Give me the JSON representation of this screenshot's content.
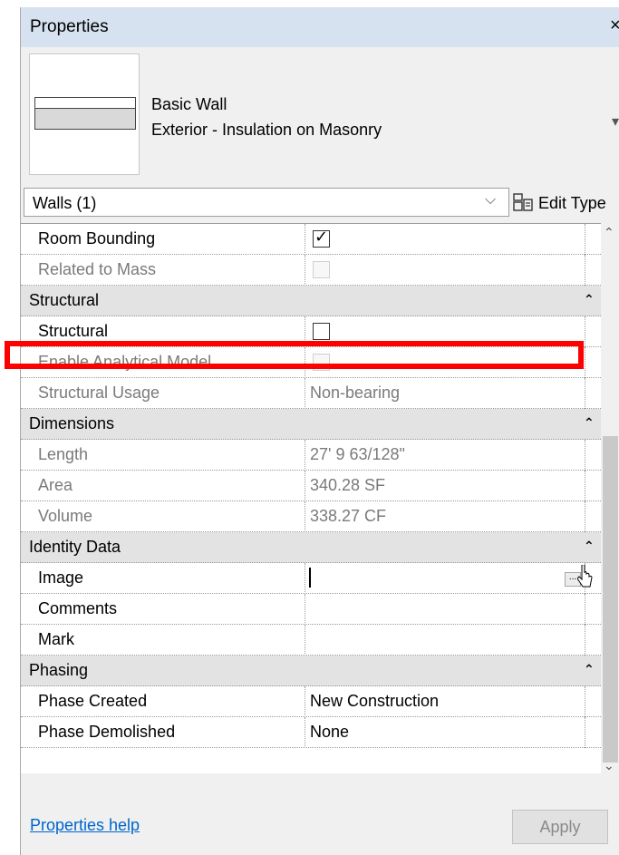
{
  "window": {
    "title": "Properties",
    "close_glyph": "×"
  },
  "type_selector": {
    "family": "Basic Wall",
    "type": "Exterior - Insulation on Masonry"
  },
  "filter": {
    "selected": "Walls (1)",
    "edit_type_label": "Edit Type"
  },
  "rows": {
    "room_bounding": {
      "name": "Room Bounding",
      "checked": true,
      "enabled": true
    },
    "related_to_mass": {
      "name": "Related to Mass",
      "checked": false,
      "enabled": false
    },
    "structural_group": {
      "name": "Structural"
    },
    "structural": {
      "name": "Structural",
      "checked": false,
      "enabled": true
    },
    "enable_analytical": {
      "name": "Enable Analytical Model",
      "checked": false,
      "enabled": false
    },
    "structural_usage": {
      "name": "Structural Usage",
      "value": "Non-bearing"
    },
    "dimensions_group": {
      "name": "Dimensions"
    },
    "length": {
      "name": "Length",
      "value": "27'  9 63/128\""
    },
    "area": {
      "name": "Area",
      "value": "340.28 SF"
    },
    "volume": {
      "name": "Volume",
      "value": "338.27 CF"
    },
    "identity_group": {
      "name": "Identity Data"
    },
    "image": {
      "name": "Image",
      "value": "",
      "browse_glyph": "..."
    },
    "comments": {
      "name": "Comments",
      "value": ""
    },
    "mark": {
      "name": "Mark",
      "value": ""
    },
    "phasing_group": {
      "name": "Phasing"
    },
    "phase_created": {
      "name": "Phase Created",
      "value": "New Construction"
    },
    "phase_demolished": {
      "name": "Phase Demolished",
      "value": "None"
    }
  },
  "footer": {
    "help_link": "Properties help",
    "apply_label": "Apply"
  },
  "colors": {
    "highlight": "#ff0000",
    "title_bar": "#d6e2f0",
    "group_row": "#e3e3e3",
    "link": "#0066cc"
  }
}
